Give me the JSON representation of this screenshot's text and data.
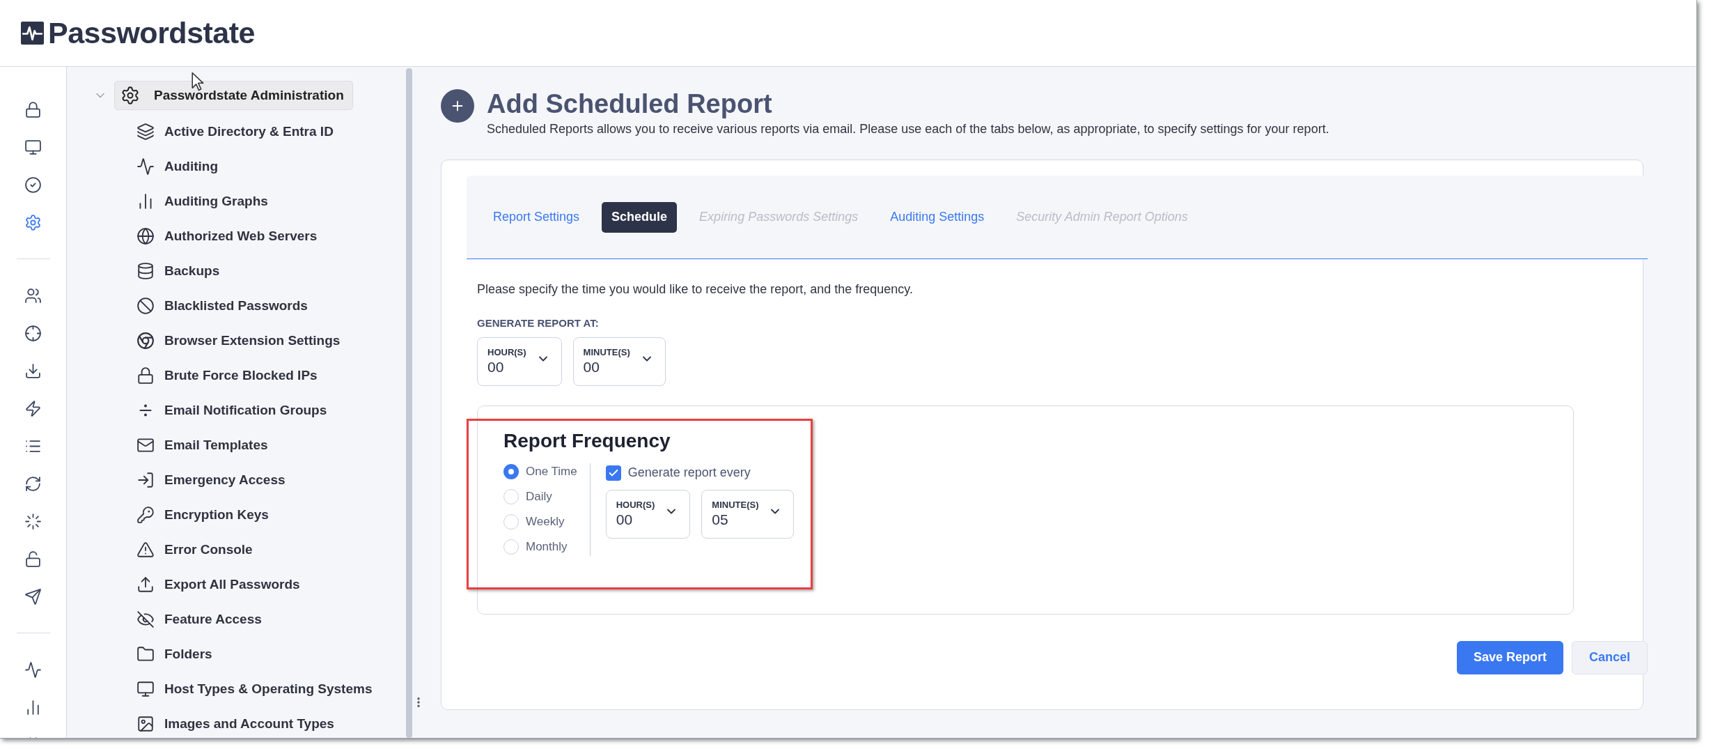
{
  "app": {
    "title": "Passwordstate"
  },
  "rail": [
    [
      {
        "selected": false
      },
      {
        "selected": false
      },
      {
        "selected": false
      },
      {
        "selected": true
      }
    ],
    [
      {
        "selected": false
      },
      {
        "selected": false
      },
      {
        "selected": false
      },
      {
        "selected": false
      },
      {
        "selected": false
      },
      {
        "selected": false
      },
      {
        "selected": false
      },
      {
        "selected": false
      },
      {
        "selected": false
      }
    ],
    [
      {
        "selected": false
      },
      {
        "selected": false
      },
      {
        "selected": false
      }
    ]
  ],
  "sidebar": {
    "root": {
      "label": "Passwordstate Administration",
      "expanded": true,
      "selected": true,
      "children": [
        {
          "label": "Active Directory & Entra ID"
        },
        {
          "label": "Auditing"
        },
        {
          "label": "Auditing Graphs"
        },
        {
          "label": "Authorized Web Servers"
        },
        {
          "label": "Backups"
        },
        {
          "label": "Blacklisted Passwords"
        },
        {
          "label": "Browser Extension Settings"
        },
        {
          "label": "Brute Force Blocked IPs"
        },
        {
          "label": "Email Notification Groups"
        },
        {
          "label": "Email Templates"
        },
        {
          "label": "Emergency Access"
        },
        {
          "label": "Encryption Keys"
        },
        {
          "label": "Error Console"
        },
        {
          "label": "Export All Passwords"
        },
        {
          "label": "Feature Access"
        },
        {
          "label": "Folders"
        },
        {
          "label": "Host Types & Operating Systems"
        },
        {
          "label": "Images and Account Types"
        }
      ]
    }
  },
  "page": {
    "title": "Add Scheduled Report",
    "subtitle": "Scheduled Reports allows you to receive various reports via email. Please use each of the tabs below, as appropriate, to specify settings for your report."
  },
  "tabs": [
    {
      "label": "Report Settings",
      "selected": false,
      "disabled": false
    },
    {
      "label": "Schedule",
      "selected": true,
      "disabled": false
    },
    {
      "label": "Expiring Passwords Settings",
      "selected": false,
      "disabled": true
    },
    {
      "label": "Auditing Settings",
      "selected": false,
      "disabled": false
    },
    {
      "label": "Security Admin Report Options",
      "selected": false,
      "disabled": true
    }
  ],
  "schedule": {
    "instructions": "Please specify the time you would like to receive the report, and the frequency.",
    "generate_at_label": "GENERATE REPORT AT:",
    "generate_at": [
      {
        "label": "HOUR(S)",
        "value": "00"
      },
      {
        "label": "MINUTE(S)",
        "value": "00"
      }
    ]
  },
  "frequency": {
    "title": "Report Frequency",
    "options": [
      {
        "label": "One Time",
        "selected": true
      },
      {
        "label": "Daily",
        "selected": false
      },
      {
        "label": "Weekly",
        "selected": false
      },
      {
        "label": "Monthly",
        "selected": false
      }
    ],
    "repeat": {
      "label": "Generate report every",
      "checked": true
    },
    "interval": [
      {
        "label": "HOUR(S)",
        "value": "00"
      },
      {
        "label": "MINUTE(S)",
        "value": "05"
      }
    ]
  },
  "buttons": [
    {
      "label": "Save Report",
      "kind": "primary"
    },
    {
      "label": "Cancel",
      "kind": "secondary"
    }
  ]
}
